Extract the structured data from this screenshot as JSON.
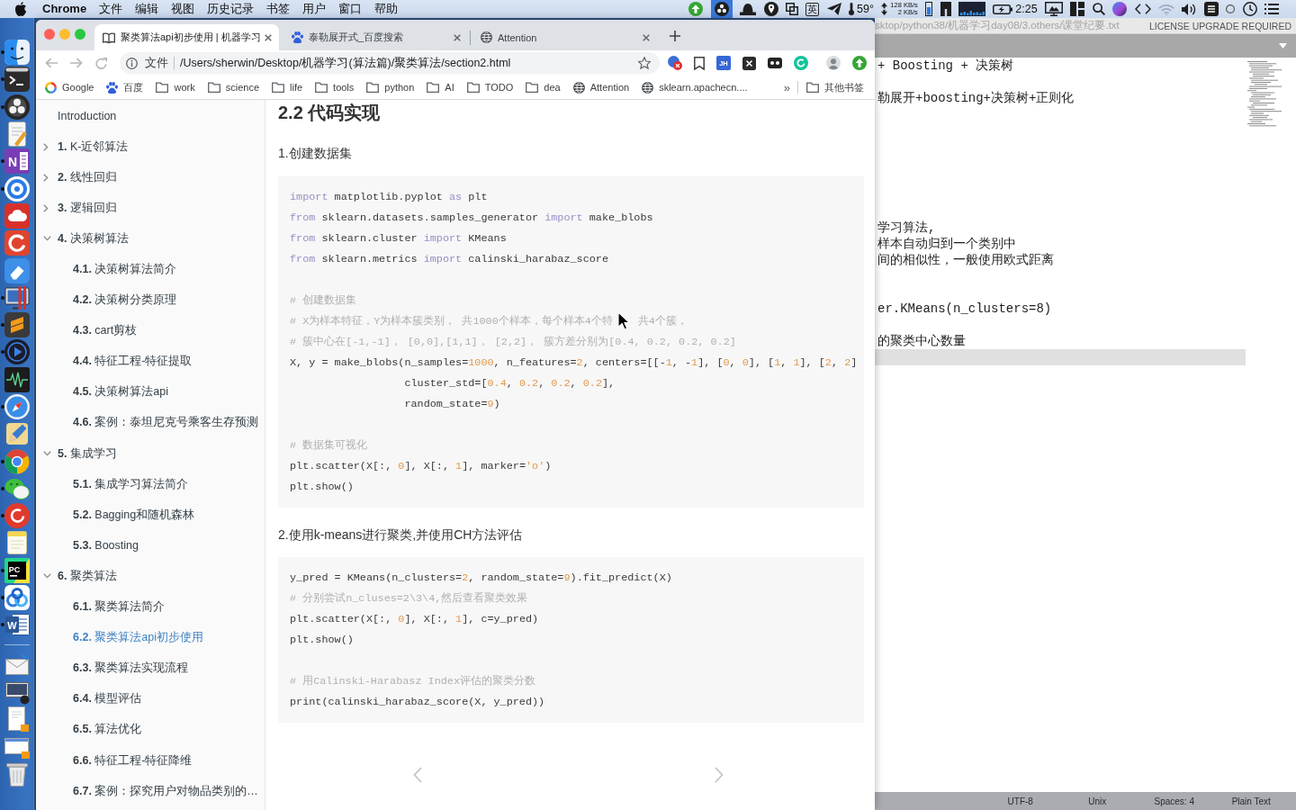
{
  "menubar": {
    "app_name": "Chrome",
    "menus": [
      "文件",
      "编辑",
      "视图",
      "历史记录",
      "书签",
      "用户",
      "窗口",
      "帮助"
    ],
    "status_items": [
      {
        "kind": "upload",
        "highlighted": false
      },
      {
        "kind": "three-dots",
        "highlighted": true
      },
      {
        "kind": "hat",
        "highlighted": false
      },
      {
        "kind": "pin",
        "highlighted": false
      },
      {
        "kind": "squares",
        "highlighted": false
      },
      {
        "kind": "input-method",
        "text": "英",
        "highlighted": false
      },
      {
        "kind": "plane",
        "highlighted": false
      },
      {
        "kind": "weather",
        "text": "59°",
        "highlighted": false
      },
      {
        "kind": "network",
        "upload": "128 KB/s",
        "download": "2 KB/s",
        "highlighted": false
      },
      {
        "kind": "memory",
        "highlighted": false
      },
      {
        "kind": "split-panel",
        "highlighted": false
      },
      {
        "kind": "cpu",
        "highlighted": false
      },
      {
        "kind": "battery",
        "text": "2:25",
        "highlighted": false
      },
      {
        "kind": "display",
        "highlighted": false
      },
      {
        "kind": "panels",
        "highlighted": false
      },
      {
        "kind": "search",
        "highlighted": false
      },
      {
        "kind": "orb",
        "highlighted": false
      },
      {
        "kind": "brackets",
        "highlighted": false
      },
      {
        "kind": "wifi",
        "highlighted": false
      },
      {
        "kind": "volume",
        "highlighted": false
      },
      {
        "kind": "stripes-tile",
        "highlighted": false
      },
      {
        "kind": "circle",
        "highlighted": false
      },
      {
        "kind": "clock",
        "highlighted": false
      },
      {
        "kind": "list",
        "highlighted": false
      }
    ]
  },
  "dock": {
    "apps": [
      {
        "kind": "finder",
        "running": true
      },
      {
        "kind": "terminal",
        "running": true
      },
      {
        "kind": "obs",
        "running": true
      },
      {
        "kind": "textedit",
        "running": false
      },
      {
        "kind": "notebook",
        "label": "N",
        "running": true
      },
      {
        "kind": "target",
        "running": true
      },
      {
        "kind": "cloud",
        "running": false
      },
      {
        "kind": "arc-tile",
        "running": false
      },
      {
        "kind": "eraser",
        "running": false
      },
      {
        "kind": "monitor",
        "running": true
      },
      {
        "kind": "stripes",
        "running": true
      },
      {
        "kind": "player",
        "running": true
      },
      {
        "kind": "waveform",
        "running": false
      },
      {
        "kind": "compass",
        "running": true
      },
      {
        "kind": "pencil",
        "running": false
      },
      {
        "kind": "segmented-circle",
        "running": true
      },
      {
        "kind": "chat",
        "running": true
      },
      {
        "kind": "arc-circle",
        "running": true
      },
      {
        "kind": "notepad",
        "running": false
      },
      {
        "kind": "letter-tile",
        "label": "PC",
        "running": true
      },
      {
        "kind": "linked-circles",
        "running": true
      },
      {
        "kind": "document-tile",
        "label": "W",
        "running": true
      }
    ],
    "documents": [
      {
        "kind": "envelope"
      },
      {
        "kind": "screen-thumbnail"
      },
      {
        "kind": "document"
      },
      {
        "kind": "window-thumbnail"
      },
      {
        "kind": "trash"
      }
    ]
  },
  "browser": {
    "tabs": [
      {
        "kind": "book",
        "title": "聚类算法api初步使用 | 机器学习",
        "selected": true
      },
      {
        "kind": "paw",
        "title": "泰勒展开式_百度搜索",
        "selected": false
      },
      {
        "kind": "globe",
        "title": "Attention",
        "selected": false
      }
    ],
    "address_bar": {
      "scheme": "文件",
      "url": "/Users/sherwin/Desktop/机器学习(算法篇)/聚类算法/section2.html"
    },
    "extensions": [
      {
        "kind": "badge-cross"
      },
      {
        "kind": "bookmark"
      },
      {
        "kind": "text-tile",
        "text": "JH"
      },
      {
        "kind": "x-square"
      },
      {
        "kind": "two-dot-tile"
      },
      {
        "kind": "arc-circle"
      },
      {
        "kind": "avatar"
      },
      {
        "kind": "upload"
      }
    ],
    "bookmarks": [
      {
        "kind": "google",
        "label": "Google"
      },
      {
        "kind": "paw",
        "label": "百度"
      },
      {
        "kind": "folder",
        "label": "work"
      },
      {
        "kind": "folder",
        "label": "science"
      },
      {
        "kind": "folder",
        "label": "life"
      },
      {
        "kind": "folder",
        "label": "tools"
      },
      {
        "kind": "folder",
        "label": "python"
      },
      {
        "kind": "folder",
        "label": "AI"
      },
      {
        "kind": "folder",
        "label": "TODO"
      },
      {
        "kind": "folder",
        "label": "dea"
      },
      {
        "kind": "globe",
        "label": "Attention"
      },
      {
        "kind": "globe",
        "label": "sklearn.apachecn...."
      }
    ],
    "bookmarks_overflow": "»",
    "other_bookmarks": {
      "kind": "folder",
      "label": "其他书签"
    },
    "sidebar": {
      "items": [
        {
          "title": "Introduction",
          "selected": false
        },
        {
          "number": "1.",
          "title": "K-近邻算法",
          "expanded": false,
          "selected": false
        },
        {
          "number": "2.",
          "title": "线性回归",
          "expanded": false,
          "selected": false
        },
        {
          "number": "3.",
          "title": "逻辑回归",
          "expanded": false,
          "selected": false
        },
        {
          "number": "4.",
          "title": "决策树算法",
          "expanded": true,
          "selected": false,
          "children": [
            {
              "number": "4.1.",
              "title": "决策树算法简介",
              "selected": false
            },
            {
              "number": "4.2.",
              "title": "决策树分类原理",
              "selected": false
            },
            {
              "number": "4.3.",
              "title": "cart剪枝",
              "selected": false
            },
            {
              "number": "4.4.",
              "title": "特征工程-特征提取",
              "selected": false
            },
            {
              "number": "4.5.",
              "title": "决策树算法api",
              "selected": false
            },
            {
              "number": "4.6.",
              "title": "案例：泰坦尼克号乘客生存预测",
              "selected": false
            }
          ]
        },
        {
          "number": "5.",
          "title": "集成学习",
          "expanded": true,
          "selected": false,
          "children": [
            {
              "number": "5.1.",
              "title": "集成学习算法简介",
              "selected": false
            },
            {
              "number": "5.2.",
              "title": "Bagging和随机森林",
              "selected": false
            },
            {
              "number": "5.3.",
              "title": "Boosting",
              "selected": false
            }
          ]
        },
        {
          "number": "6.",
          "title": "聚类算法",
          "expanded": true,
          "selected": false,
          "children": [
            {
              "number": "6.1.",
              "title": "聚类算法简介",
              "selected": false
            },
            {
              "number": "6.2.",
              "title": "聚类算法api初步使用",
              "selected": true
            },
            {
              "number": "6.3.",
              "title": "聚类算法实现流程",
              "selected": false
            },
            {
              "number": "6.4.",
              "title": "模型评估",
              "selected": false
            },
            {
              "number": "6.5.",
              "title": "算法优化",
              "selected": false
            },
            {
              "number": "6.6.",
              "title": "特征工程-特征降维",
              "selected": false
            },
            {
              "number": "6.7.",
              "title": "案例：探究用户对物品类别的…",
              "selected": false
            }
          ]
        }
      ]
    },
    "article": {
      "heading": "2.2 代码实现",
      "blocks": [
        {
          "kind": "paragraph",
          "text": "1.创建数据集"
        },
        {
          "kind": "code",
          "lines": [
            {
              "kind": "code",
              "tokens": [
                {
                  "text": "import",
                  "kind": "keyword"
                },
                {
                  "text": " matplotlib.pyplot ",
                  "kind": "plain"
                },
                {
                  "text": "as",
                  "kind": "keyword"
                },
                {
                  "text": " plt",
                  "kind": "plain"
                }
              ]
            },
            {
              "kind": "code",
              "tokens": [
                {
                  "text": "from",
                  "kind": "keyword"
                },
                {
                  "text": " sklearn.datasets.samples_generator ",
                  "kind": "plain"
                },
                {
                  "text": "import",
                  "kind": "keyword"
                },
                {
                  "text": " make_blobs",
                  "kind": "plain"
                }
              ]
            },
            {
              "kind": "code",
              "tokens": [
                {
                  "text": "from",
                  "kind": "keyword"
                },
                {
                  "text": " sklearn.cluster ",
                  "kind": "plain"
                },
                {
                  "text": "import",
                  "kind": "keyword"
                },
                {
                  "text": " KMeans",
                  "kind": "plain"
                }
              ]
            },
            {
              "kind": "code",
              "tokens": [
                {
                  "text": "from",
                  "kind": "keyword"
                },
                {
                  "text": " sklearn.metrics ",
                  "kind": "plain"
                },
                {
                  "text": "import",
                  "kind": "keyword"
                },
                {
                  "text": " calinski_harabaz_score",
                  "kind": "plain"
                }
              ]
            },
            {
              "kind": "blank"
            },
            {
              "kind": "code",
              "tokens": [
                {
                  "text": "# 创建数据集",
                  "kind": "comment"
                }
              ]
            },
            {
              "kind": "code",
              "tokens": [
                {
                  "text": "# X为样本特征，Y为样本簇类别， 共1000个样本，每个样本4个特",
                  "kind": "comment"
                },
                {
                  "kind": "pointer"
                },
                {
                  "text": "共4个簇，",
                  "kind": "comment"
                }
              ]
            },
            {
              "kind": "code",
              "tokens": [
                {
                  "text": "# 簇中心在[-1,-1]， [0,0],[1,1]， [2,2]， 簇方差分别为[0.4, 0.2, 0.2, 0.2]",
                  "kind": "comment"
                }
              ]
            },
            {
              "kind": "code",
              "tokens": [
                {
                  "text": "X, y = make_blobs(n_samples=",
                  "kind": "plain"
                },
                {
                  "text": "1000",
                  "kind": "number"
                },
                {
                  "text": ", n_features=",
                  "kind": "plain"
                },
                {
                  "text": "2",
                  "kind": "number"
                },
                {
                  "text": ", centers=[[-",
                  "kind": "plain"
                },
                {
                  "text": "1",
                  "kind": "number"
                },
                {
                  "text": ", -",
                  "kind": "plain"
                },
                {
                  "text": "1",
                  "kind": "number"
                },
                {
                  "text": "], [",
                  "kind": "plain"
                },
                {
                  "text": "0",
                  "kind": "number"
                },
                {
                  "text": ", ",
                  "kind": "plain"
                },
                {
                  "text": "0",
                  "kind": "number"
                },
                {
                  "text": "], [",
                  "kind": "plain"
                },
                {
                  "text": "1",
                  "kind": "number"
                },
                {
                  "text": ", ",
                  "kind": "plain"
                },
                {
                  "text": "1",
                  "kind": "number"
                },
                {
                  "text": "], [",
                  "kind": "plain"
                },
                {
                  "text": "2",
                  "kind": "number"
                },
                {
                  "text": ", ",
                  "kind": "plain"
                },
                {
                  "text": "2",
                  "kind": "number"
                },
                {
                  "text": "]",
                  "kind": "plain"
                }
              ]
            },
            {
              "kind": "code",
              "tokens": [
                {
                  "text": "                  cluster_std=[",
                  "kind": "plain"
                },
                {
                  "text": "0.4",
                  "kind": "number"
                },
                {
                  "text": ", ",
                  "kind": "plain"
                },
                {
                  "text": "0.2",
                  "kind": "number"
                },
                {
                  "text": ", ",
                  "kind": "plain"
                },
                {
                  "text": "0.2",
                  "kind": "number"
                },
                {
                  "text": ", ",
                  "kind": "plain"
                },
                {
                  "text": "0.2",
                  "kind": "number"
                },
                {
                  "text": "],",
                  "kind": "plain"
                }
              ]
            },
            {
              "kind": "code",
              "tokens": [
                {
                  "text": "                  random_state=",
                  "kind": "plain"
                },
                {
                  "text": "9",
                  "kind": "number"
                },
                {
                  "text": ")",
                  "kind": "plain"
                }
              ]
            },
            {
              "kind": "blank"
            },
            {
              "kind": "code",
              "tokens": [
                {
                  "text": "# 数据集可视化",
                  "kind": "comment"
                }
              ]
            },
            {
              "kind": "code",
              "tokens": [
                {
                  "text": "plt.scatter(X[:, ",
                  "kind": "plain"
                },
                {
                  "text": "0",
                  "kind": "number"
                },
                {
                  "text": "], X[:, ",
                  "kind": "plain"
                },
                {
                  "text": "1",
                  "kind": "number"
                },
                {
                  "text": "], marker=",
                  "kind": "plain"
                },
                {
                  "text": "'o'",
                  "kind": "string"
                },
                {
                  "text": ")",
                  "kind": "plain"
                }
              ]
            },
            {
              "kind": "code",
              "tokens": [
                {
                  "text": "plt.show()",
                  "kind": "plain"
                }
              ]
            }
          ]
        },
        {
          "kind": "paragraph",
          "text": "2.使用k-means进行聚类,并使用CH方法评估"
        },
        {
          "kind": "code",
          "lines": [
            {
              "kind": "code",
              "tokens": [
                {
                  "text": "y_pred = KMeans(n_clusters=",
                  "kind": "plain"
                },
                {
                  "text": "2",
                  "kind": "number"
                },
                {
                  "text": ", random_state=",
                  "kind": "plain"
                },
                {
                  "text": "9",
                  "kind": "number"
                },
                {
                  "text": ").fit_predict(X)",
                  "kind": "plain"
                }
              ]
            },
            {
              "kind": "code",
              "tokens": [
                {
                  "text": "# 分别尝试n_cluses=2\\3\\4,然后查看聚类效果",
                  "kind": "comment"
                }
              ]
            },
            {
              "kind": "code",
              "tokens": [
                {
                  "text": "plt.scatter(X[:, ",
                  "kind": "plain"
                },
                {
                  "text": "0",
                  "kind": "number"
                },
                {
                  "text": "], X[:, ",
                  "kind": "plain"
                },
                {
                  "text": "1",
                  "kind": "number"
                },
                {
                  "text": "], c=y_pred)",
                  "kind": "plain"
                }
              ]
            },
            {
              "kind": "code",
              "tokens": [
                {
                  "text": "plt.show()",
                  "kind": "plain"
                }
              ]
            },
            {
              "kind": "blank"
            },
            {
              "kind": "code",
              "tokens": [
                {
                  "text": "# 用Calinski-Harabasz Index评估的聚类分数",
                  "kind": "comment"
                }
              ]
            },
            {
              "kind": "code",
              "tokens": [
                {
                  "text": "print(calinski_harabaz_score(X, y_pred))",
                  "kind": "plain"
                }
              ]
            }
          ]
        }
      ]
    }
  },
  "editor": {
    "title": "sktop/python38/机器学习day08/3.others/课堂纪要.txt",
    "license": "LICENSE UPGRADE REQUIRED",
    "lines": [
      {
        "kind": "text",
        "text": "+ Boosting + 决策树",
        "current": false
      },
      {
        "kind": "blank",
        "current": false
      },
      {
        "kind": "text",
        "text": "勒展开+boosting+决策树+正则化",
        "current": false
      },
      {
        "kind": "blank",
        "current": false
      },
      {
        "kind": "blank",
        "current": false
      },
      {
        "kind": "blank",
        "current": false
      },
      {
        "kind": "blank",
        "current": false
      },
      {
        "kind": "blank",
        "current": false
      },
      {
        "kind": "blank",
        "current": false
      },
      {
        "kind": "blank",
        "current": false
      },
      {
        "kind": "text",
        "text": "学习算法,",
        "current": false
      },
      {
        "kind": "text",
        "text": "样本自动归到一个类别中",
        "current": false
      },
      {
        "kind": "text",
        "text": "间的相似性，一般使用欧式距离",
        "current": false
      },
      {
        "kind": "blank",
        "current": false
      },
      {
        "kind": "blank",
        "current": false
      },
      {
        "kind": "text",
        "text": "er.KMeans(n_clusters=8)",
        "current": false
      },
      {
        "kind": "blank",
        "current": false
      },
      {
        "kind": "text",
        "text": "的聚类中心数量",
        "current": false
      },
      {
        "kind": "blank",
        "current": true
      }
    ],
    "status": [
      "UTF-8",
      "Unix",
      "Spaces: 4",
      "Plain Text"
    ]
  }
}
